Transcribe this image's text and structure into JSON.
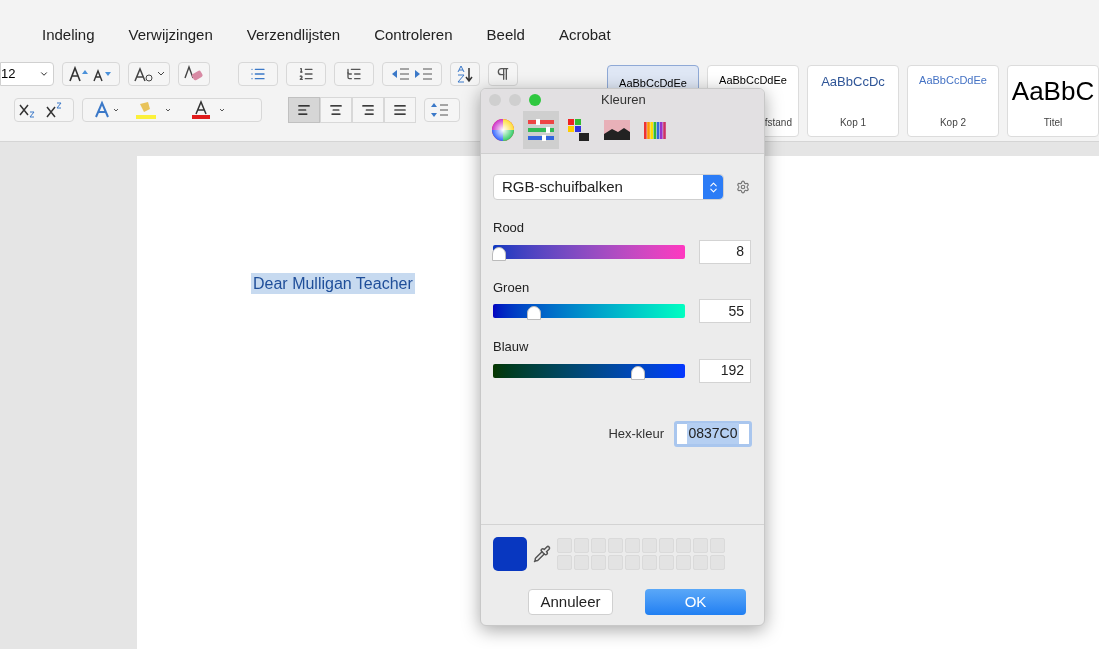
{
  "menu_tabs": [
    {
      "label": "Indeling"
    },
    {
      "label": "Verwijzingen"
    },
    {
      "label": "Verzendlijsten"
    },
    {
      "label": "Controleren"
    },
    {
      "label": "Beeld"
    },
    {
      "label": "Acrobat"
    }
  ],
  "font_size": "12",
  "styles": [
    {
      "preview": "AaBbCcDdEe",
      "selected": true,
      "kind": "normal"
    },
    {
      "preview": "AaBbCcDdEe",
      "label": "fstand",
      "selected": false,
      "kind": "normal"
    },
    {
      "preview": "AaBbCcDc",
      "label": "Kop 1",
      "selected": false,
      "kind": "heading1"
    },
    {
      "preview": "AaBbCcDdEe",
      "label": "Kop 2",
      "selected": false,
      "kind": "heading2"
    },
    {
      "preview": "AaBbC",
      "label": "Titel",
      "selected": false,
      "kind": "title"
    }
  ],
  "document": {
    "text": "Dear Mulligan Teacher",
    "highlighted": true
  },
  "color_panel": {
    "title": "Kleuren",
    "modes": [
      {
        "kind": "wheel",
        "selected": false
      },
      {
        "kind": "sliders",
        "selected": true
      },
      {
        "kind": "palettes",
        "selected": false
      },
      {
        "kind": "image",
        "selected": false
      },
      {
        "kind": "pencils",
        "selected": false
      }
    ],
    "mode_select": "RGB-schuifbalken",
    "sliders": [
      {
        "label": "Rood",
        "kind": "red",
        "level": 0.031,
        "value": "8"
      },
      {
        "label": "Groen",
        "kind": "green",
        "level": 0.216,
        "value": "55"
      },
      {
        "label": "Blauw",
        "kind": "blue",
        "level": 0.753,
        "value": "192"
      }
    ],
    "hex_label": "Hex-kleur",
    "hex_value": "0837C0",
    "buttons": {
      "cancel": "Annuleer",
      "ok": "OK"
    }
  }
}
